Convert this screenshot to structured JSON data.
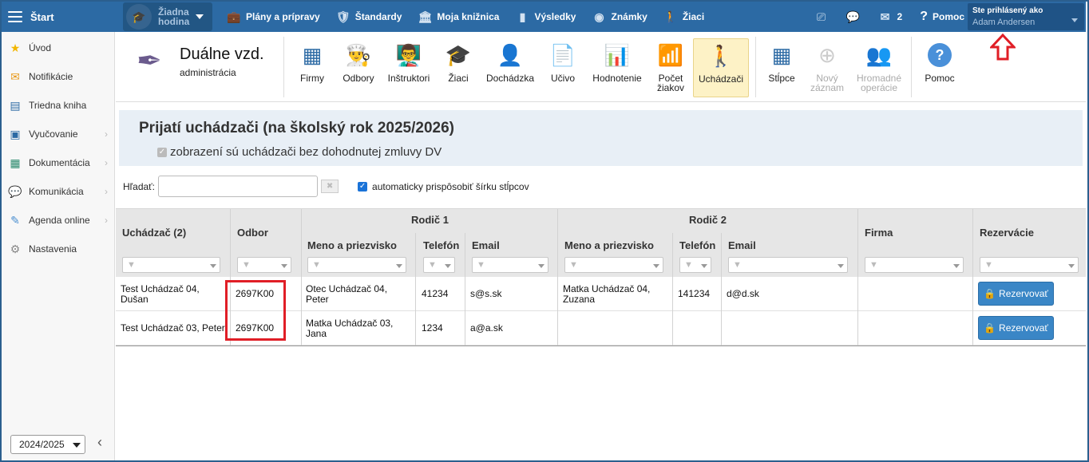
{
  "topbar": {
    "start_label": "Štart",
    "hodina_label_1": "Žiadna",
    "hodina_label_2": "hodina",
    "nav": [
      {
        "label": "Plány a prípravy",
        "icon": "briefcase-icon"
      },
      {
        "label": "Štandardy",
        "icon": "shield-icon"
      },
      {
        "label": "Moja knižnica",
        "icon": "library-icon"
      },
      {
        "label": "Výsledky",
        "icon": "bar-chart-icon"
      },
      {
        "label": "Známky",
        "icon": "grade-icon"
      },
      {
        "label": "Žiaci",
        "icon": "students-icon"
      }
    ],
    "messages_count": "2",
    "help_label": "Pomoc",
    "user_line1": "Ste prihlásený ako",
    "user_line2": "Adam Andersen",
    "bg_color": "#2c6aa4"
  },
  "sidebar": {
    "items": [
      {
        "label": "Úvod",
        "icon": "star-icon"
      },
      {
        "label": "Notifikácie",
        "icon": "envelope-icon"
      },
      {
        "label": "Triedna kniha",
        "icon": "book-icon"
      },
      {
        "label": "Vyučovanie",
        "icon": "classroom-icon"
      },
      {
        "label": "Dokumentácia",
        "icon": "document-icon"
      },
      {
        "label": "Komunikácia",
        "icon": "chat-icon"
      },
      {
        "label": "Agenda online",
        "icon": "pencil-icon"
      },
      {
        "label": "Nastavenia",
        "icon": "gear-icon"
      }
    ],
    "year": "2024/2025"
  },
  "module": {
    "title": "Duálne vzd.",
    "subtitle": "administrácia",
    "buttons": [
      {
        "label": "Firmy"
      },
      {
        "label": "Odbory"
      },
      {
        "label": "Inštruktori"
      },
      {
        "label": "Žiaci"
      },
      {
        "label": "Dochádzka"
      },
      {
        "label": "Učivo"
      },
      {
        "label": "Hodnotenie"
      },
      {
        "label_1": "Počet",
        "label_2": "žiakov"
      },
      {
        "label": "Uchádzači"
      },
      {
        "label": "Stĺpce"
      },
      {
        "label_1": "Nový",
        "label_2": "záznam"
      },
      {
        "label_1": "Hromadné",
        "label_2": "operácie"
      },
      {
        "label": "Pomoc"
      }
    ]
  },
  "content": {
    "page_title": "Prijatí uchádzači (na školský rok 2025/2026)",
    "filter_checkbox_label": "zobrazení sú uchádzači bez dohodnutej zmluvy DV",
    "search_label": "Hľadať:",
    "search_value": "",
    "auto_width_label": "automaticky prispôsobiť šírku stĺpcov"
  },
  "grid": {
    "headers": {
      "uchadzac": "Uchádzač (2)",
      "odbor": "Odbor",
      "rodic1": "Rodič 1",
      "rodic2": "Rodič 2",
      "meno1": "Meno a priezvisko",
      "telefon1": "Telefón",
      "email1": "Email",
      "meno2": "Meno a priezvisko",
      "telefon2": "Telefón",
      "email2": "Email",
      "firma": "Firma",
      "rezervacie": "Rezervácie"
    },
    "rows": [
      {
        "uchadzac_1": "Test Uchádzač 04,",
        "uchadzac_2": "Dušan",
        "odbor": "2697K00",
        "r1_meno_1": "Otec Uchádzač 04,",
        "r1_meno_2": "Peter",
        "r1_telefon": "41234",
        "r1_email": "s@s.sk",
        "r2_meno_1": "Matka Uchádzač 04,",
        "r2_meno_2": "Zuzana",
        "r2_telefon": "141234",
        "r2_email": "d@d.sk",
        "firma": "",
        "button": "Rezervovať"
      },
      {
        "uchadzac_1": "Test Uchádzač 03, Peter",
        "uchadzac_2": "",
        "odbor": "2697K00",
        "r1_meno_1": "Matka Uchádzač 03,",
        "r1_meno_2": "Jana",
        "r1_telefon": "1234",
        "r1_email": "a@a.sk",
        "r2_meno_1": "",
        "r2_meno_2": "",
        "r2_telefon": "",
        "r2_email": "",
        "firma": "",
        "button": "Rezervovať"
      }
    ]
  }
}
